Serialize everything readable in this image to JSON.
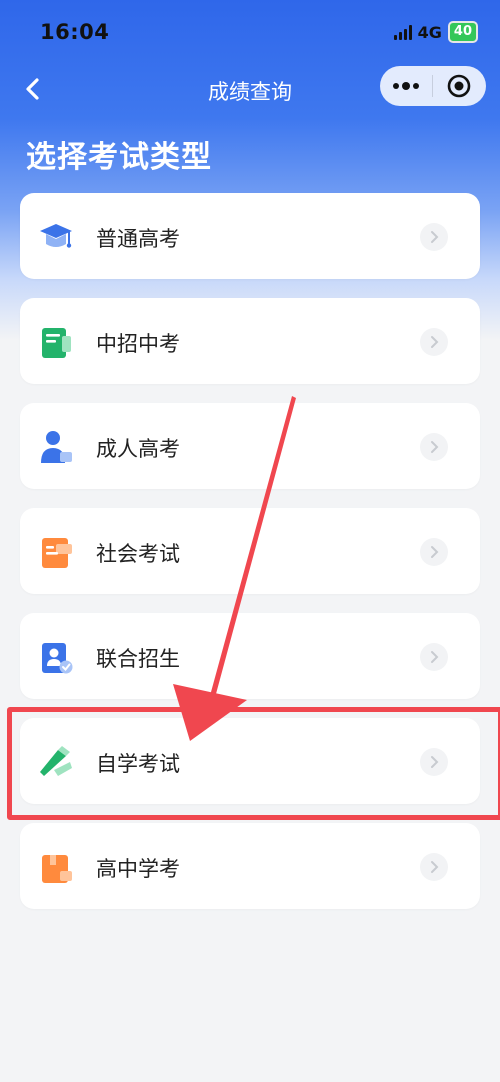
{
  "status_bar": {
    "time": "16:04",
    "network": "4G",
    "battery": "40"
  },
  "nav": {
    "title": "成绩查询",
    "back_icon": "chevron-left-icon",
    "more_icon": "more-dots-icon",
    "close_icon": "target-circle-icon"
  },
  "page": {
    "title": "选择考试类型"
  },
  "exam_types": [
    {
      "label": "普通高考",
      "icon": "graduation-cap-icon"
    },
    {
      "label": "中招中考",
      "icon": "green-book-icon"
    },
    {
      "label": "成人高考",
      "icon": "adult-person-icon"
    },
    {
      "label": "社会考试",
      "icon": "orange-document-icon"
    },
    {
      "label": "联合招生",
      "icon": "id-card-check-icon"
    },
    {
      "label": "自学考试",
      "icon": "green-pen-icon"
    },
    {
      "label": "高中学考",
      "icon": "orange-box-icon"
    }
  ],
  "annotation": {
    "highlighted_item": "自学考试",
    "color": "#f0474f"
  },
  "colors": {
    "brand_blue": "#2f67ea",
    "card_bg": "#ffffff",
    "page_bg": "#f3f4f6"
  }
}
